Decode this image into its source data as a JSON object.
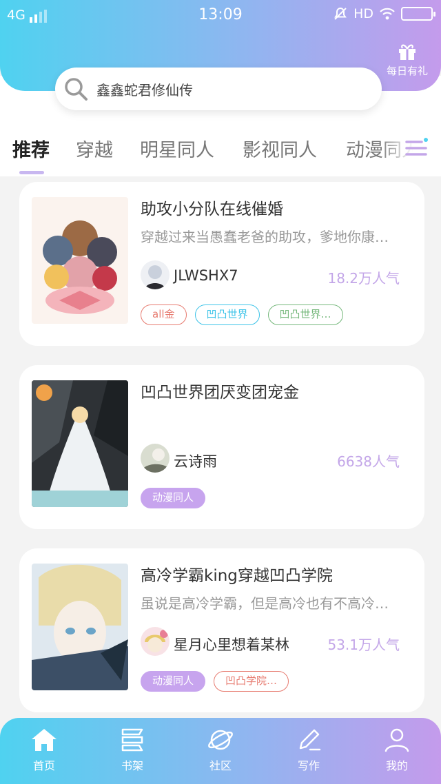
{
  "status_bar": {
    "network": "4G",
    "time": "13:09",
    "hd": "HD"
  },
  "daily_gift": {
    "label": "每日有礼"
  },
  "search": {
    "text": "鑫鑫蛇君修仙传"
  },
  "tabs": [
    "推荐",
    "穿越",
    "明星同人",
    "影视同人",
    "动漫同人"
  ],
  "books": [
    {
      "title": "助攻小分队在线催婚",
      "description": "穿越过来当愚蠢老爸的助攻，爹地你康…",
      "author": "JLWSHX7",
      "popularity": "18.2万人气",
      "tags": [
        "all金",
        "凹凸世界",
        "凹凸世界…"
      ]
    },
    {
      "title": "凹凸世界团厌变团宠金",
      "description": "",
      "author": "云诗雨",
      "popularity": "6638人气",
      "tags": [
        "动漫同人"
      ]
    },
    {
      "title": "高冷学霸king穿越凹凸学院",
      "description": "虽说是高冷学霸，但是高冷也有不高冷…",
      "author": "星月心里想着某林",
      "popularity": "53.1万人气",
      "tags": [
        "动漫同人",
        "凹凸学院…"
      ]
    }
  ],
  "bottom_nav": [
    "首页",
    "书架",
    "社区",
    "写作",
    "我的"
  ],
  "colors": {
    "gradient_start": "#4fd2f0",
    "gradient_end": "#c49bec",
    "popularity": "#c3a6e8"
  }
}
